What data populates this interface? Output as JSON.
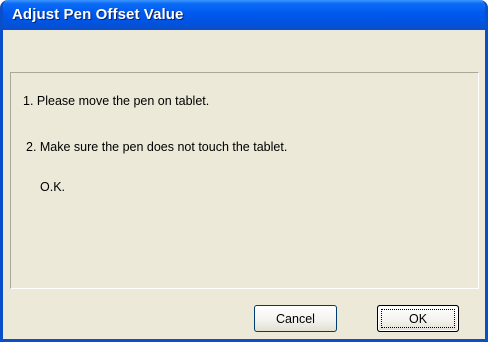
{
  "window": {
    "title": "Adjust Pen Offset Value"
  },
  "messages": {
    "line1": "1. Please move the pen on tablet.",
    "line2": "2. Make sure the pen does not touch the tablet.",
    "status": "O.K."
  },
  "buttons": {
    "cancel_label": "Cancel",
    "ok_label": "OK"
  },
  "colors": {
    "titlebar": "#0054e3",
    "dialog_bg": "#ece9d8",
    "title_text": "#ffffff"
  }
}
